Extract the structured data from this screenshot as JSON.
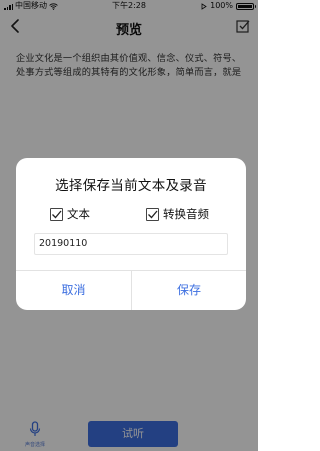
{
  "status_bar": {
    "carrier": "中国移动",
    "time": "下午2:28",
    "battery_text": "100%",
    "battery_level": 1.0
  },
  "nav": {
    "title": "预览",
    "back_icon": "chevron-left-icon",
    "edit_icon": "checkbox-edit-icon"
  },
  "article": {
    "text": "企业文化是一个组织由其价值观、信念、仪式、符号、处事方式等组成的其特有的文化形象，简单而言，就是企业"
  },
  "dialog": {
    "title": "选择保存当前文本及录音",
    "options": [
      {
        "label": "文本",
        "checked": true
      },
      {
        "label": "转换音频",
        "checked": true
      }
    ],
    "file_name": "20190110",
    "cancel_label": "取消",
    "save_label": "保存"
  },
  "bottom_bar": {
    "mic_label": "声音选择",
    "listen_label": "试听"
  },
  "colors": {
    "accent": "#3d6fe0",
    "overlay": "rgba(0,0,0,0.42)"
  }
}
